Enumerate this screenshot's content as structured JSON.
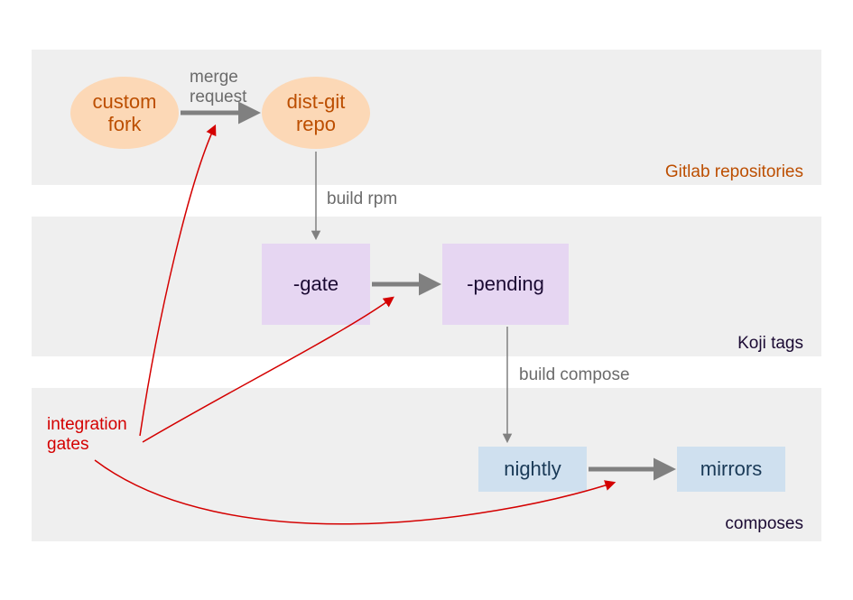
{
  "lanes": {
    "gitlab": {
      "label": "Gitlab repositories",
      "color": "#bc4e00"
    },
    "koji": {
      "label": "Koji tags",
      "color": "#1b0a33"
    },
    "composes": {
      "label": "composes",
      "color": "#1b0a33"
    }
  },
  "nodes": {
    "custom_fork": {
      "label": "custom\nfork",
      "fill": "#fcd8b6",
      "text": "#bc4e00"
    },
    "dist_git": {
      "label": "dist-git\nrepo",
      "fill": "#fcd8b6",
      "text": "#bc4e00"
    },
    "gate_tag": {
      "label": "-gate",
      "fill": "#e6d6f2",
      "text": "#1b0a33"
    },
    "pending_tag": {
      "label": "-pending",
      "fill": "#e6d6f2",
      "text": "#1b0a33"
    },
    "nightly": {
      "label": "nightly",
      "fill": "#cfe0ef",
      "text": "#1a3a57"
    },
    "mirrors": {
      "label": "mirrors",
      "fill": "#cfe0ef",
      "text": "#1a3a57"
    }
  },
  "edges": {
    "merge_request": {
      "label": "merge\nrequest"
    },
    "build_rpm": {
      "label": "build rpm"
    },
    "gate_to_pending": {
      "label": ""
    },
    "build_compose": {
      "label": "build compose"
    },
    "nightly_to_mirrors": {
      "label": ""
    }
  },
  "annotation": {
    "integration_gates": {
      "label": "integration\ngates"
    }
  }
}
